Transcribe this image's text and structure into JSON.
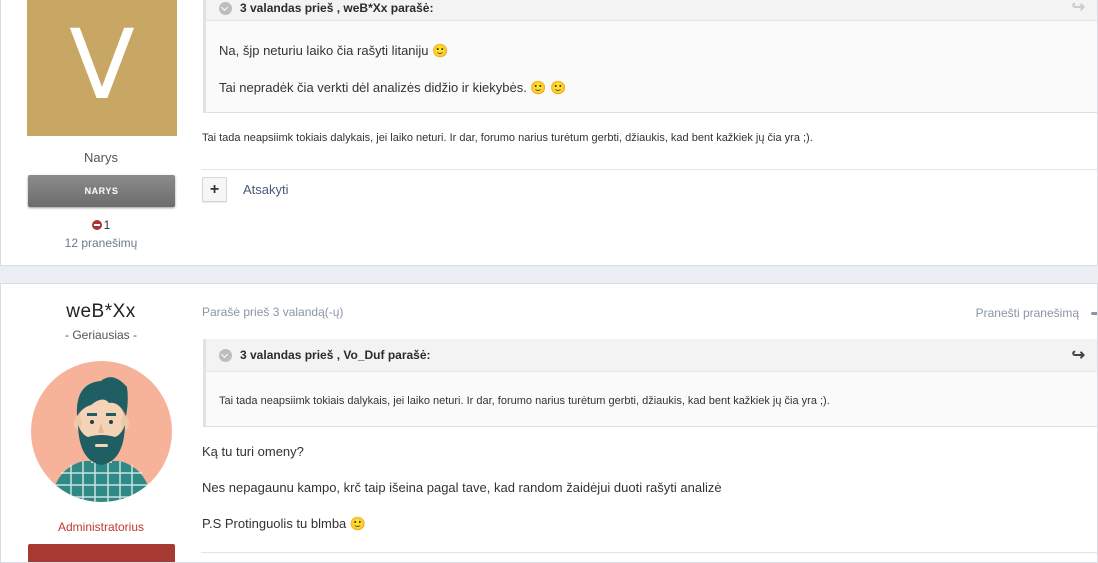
{
  "post1": {
    "avatar_letter": "V",
    "member_title": "Narys",
    "rank_badge": "NARYS",
    "reputation": "1",
    "post_count": "12 pranešimų",
    "quote": {
      "header": "3 valandas prieš , weB*Xx parašė:",
      "line1": "Na, šjp neturiu laiko čia rašyti litaniju 🙂",
      "line2": "Tai nepradėk čia verkti dėl analizės didžio ir kiekybės. 🙂 🙂"
    },
    "body_line1": "Tai tada neapsiimk tokiais dalykais, jei laiko neturi. Ir dar, forumo narius turėtum gerbti, džiaukis, kad bent kažkiek jų čia yra ;).",
    "reply_label": "Atsakyti"
  },
  "post2": {
    "username": "weB*Xx",
    "user_title": "- Geriausias -",
    "group": "Administratorius",
    "posted": "Parašė prieš 3 valandą(-ų)",
    "report_label": "Pranešti pranešimą",
    "quote": {
      "header": "3 valandas prieš , Vo_Duf parašė:",
      "line1": "Tai tada neapsiimk tokiais dalykais, jei laiko neturi. Ir dar, forumo narius turėtum gerbti, džiaukis, kad bent kažkiek jų čia yra ;)."
    },
    "body": [
      "Ką tu turi omeny?",
      "Nes nepagaunu kampo, krč taip išeina pagal tave, kad random žaidėjui duoti rašyti analizė",
      "P.S Protinguolis tu blmba 🙂"
    ]
  },
  "colors": {
    "avatar_bg": "#c8a663",
    "avatar2_bg": "#f6b39a",
    "admin_red": "#c23a2a",
    "link": "#4c5a77"
  }
}
